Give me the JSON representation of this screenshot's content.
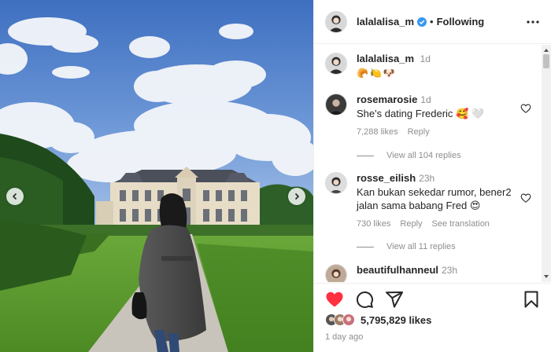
{
  "post": {
    "author": "lalalalisa_m",
    "follow_status": "Following",
    "dot": "•",
    "caption_time": "1d",
    "caption_emoji": "🥐🍋🐶",
    "likes": "5,795,829 likes",
    "posted_ago": "1 day ago"
  },
  "comments": [
    {
      "user": "rosemarosie",
      "time": "1d",
      "text": "She's dating Frederic 🥰 🤍",
      "likes": "7,288 likes",
      "reply": "Reply",
      "view_replies": "View all 104 replies"
    },
    {
      "user": "rosse_eilish",
      "time": "23h",
      "text": "Kan bukan sekedar rumor, bener2 jalan sama babang Fred 😍",
      "likes": "730 likes",
      "reply": "Reply",
      "see_translation": "See translation",
      "view_replies": "View all 11 replies"
    },
    {
      "user": "beautifulhanneul",
      "time": "23h"
    }
  ],
  "icons": {
    "like": "heart-filled-icon",
    "comment": "comment-icon",
    "share": "share-icon",
    "save": "bookmark-icon",
    "verified": "verified-badge-icon",
    "more": "more-options-icon"
  },
  "colors": {
    "like_red": "#ff3040",
    "verified_blue": "#3897f0",
    "muted_text": "#8e8e8e"
  }
}
